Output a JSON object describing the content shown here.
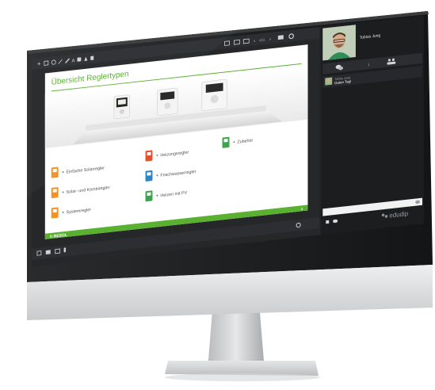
{
  "slide": {
    "title": "Übersicht Reglertypen",
    "categories": [
      {
        "label": "Einfache Solarregler",
        "icon": "orange-controller-icon",
        "color": "#f39224"
      },
      {
        "label": "Solar- und Kombiregler",
        "icon": "orange-controller-icon",
        "color": "#f39224"
      },
      {
        "label": "Systemregler",
        "icon": "orange-controller-icon",
        "color": "#f39224"
      },
      {
        "label": "Heizungsregler",
        "icon": "red-controller-icon",
        "color": "#e2522a"
      },
      {
        "label": "Frischwasserregler",
        "icon": "blue-controller-icon",
        "color": "#2b86c8"
      },
      {
        "label": "Heizen mit PV",
        "icon": "green-grid-icon",
        "color": "#3aa54a"
      },
      {
        "label": "Zubehör",
        "icon": "green-gear-icon",
        "color": "#3aa54a"
      }
    ],
    "footer_brand": "© RESOL",
    "page_number": "4",
    "accent": "#5ab031"
  },
  "presenter": {
    "name": "Tobias Jung"
  },
  "side_tabs": [
    {
      "icon": "chat-icon"
    },
    {
      "icon": "info-icon",
      "label": "i"
    },
    {
      "icon": "participants-icon"
    }
  ],
  "chat": {
    "messages": [
      {
        "author": "Tobias Jung",
        "text": "Guten Tag!"
      }
    ],
    "input_placeholder": ""
  },
  "brand": {
    "name": "edudip"
  },
  "colors": {
    "app_bg": "#222426",
    "panel_bg": "#1c1d1f",
    "toolbar_bg": "#2c2e31"
  }
}
